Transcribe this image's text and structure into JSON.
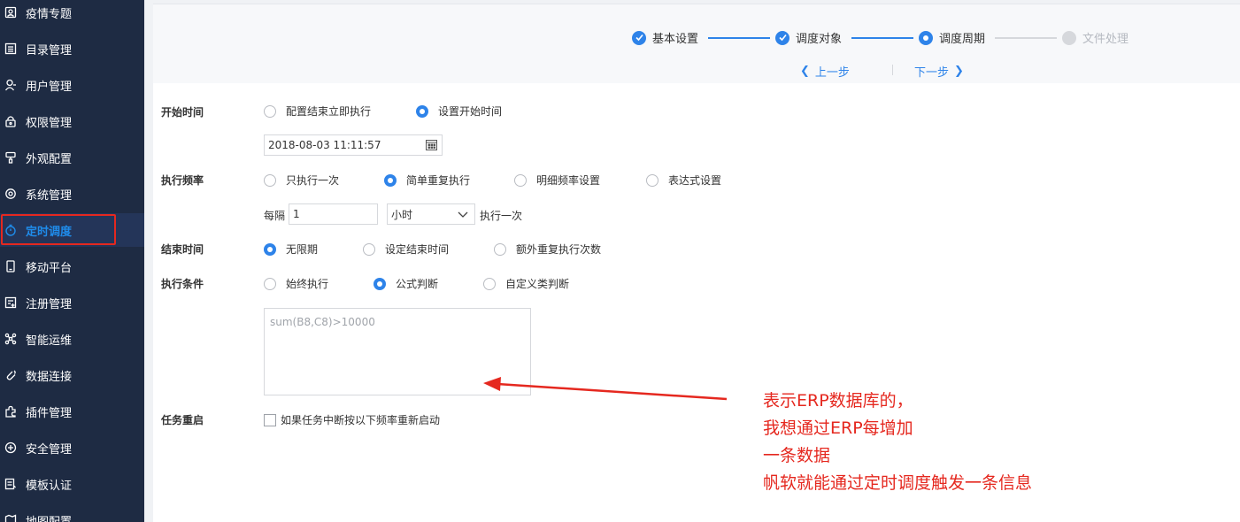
{
  "sidebar": {
    "items": [
      {
        "label": "疫情专题",
        "icon": "report-icon"
      },
      {
        "label": "目录管理",
        "icon": "list-icon"
      },
      {
        "label": "用户管理",
        "icon": "user-icon"
      },
      {
        "label": "权限管理",
        "icon": "lock-icon"
      },
      {
        "label": "外观配置",
        "icon": "brush-icon"
      },
      {
        "label": "系统管理",
        "icon": "gear-icon"
      },
      {
        "label": "定时调度",
        "icon": "timer-icon",
        "active": true
      },
      {
        "label": "移动平台",
        "icon": "mobile-icon"
      },
      {
        "label": "注册管理",
        "icon": "register-icon"
      },
      {
        "label": "智能运维",
        "icon": "network-icon"
      },
      {
        "label": "数据连接",
        "icon": "link-icon"
      },
      {
        "label": "插件管理",
        "icon": "puzzle-icon"
      },
      {
        "label": "安全管理",
        "icon": "shield-icon"
      },
      {
        "label": "模板认证",
        "icon": "template-icon"
      },
      {
        "label": "地图配置",
        "icon": "map-icon"
      }
    ],
    "active_color": "#1f8ceb"
  },
  "steps": [
    {
      "label": "基本设置",
      "status": "done"
    },
    {
      "label": "调度对象",
      "status": "done"
    },
    {
      "label": "调度周期",
      "status": "current"
    },
    {
      "label": "文件处理",
      "status": "pending"
    }
  ],
  "nav": {
    "prev": "上一步",
    "next": "下一步"
  },
  "form": {
    "start_time": {
      "label": "开始时间",
      "options": [
        "配置结束立即执行",
        "设置开始时间"
      ],
      "selected": 1,
      "datetime": "2018-08-03 11:11:57"
    },
    "frequency": {
      "label": "执行频率",
      "options": [
        "只执行一次",
        "简单重复执行",
        "明细频率设置",
        "表达式设置"
      ],
      "selected": 1,
      "every_label": "每隔",
      "every_value": "1",
      "unit": "小时",
      "suffix": "执行一次"
    },
    "end_time": {
      "label": "结束时间",
      "options": [
        "无限期",
        "设定结束时间",
        "额外重复执行次数"
      ],
      "selected": 0
    },
    "condition": {
      "label": "执行条件",
      "options": [
        "始终执行",
        "公式判断",
        "自定义类判断"
      ],
      "selected": 1,
      "formula": "sum(B8,C8)>10000"
    },
    "restart": {
      "label": "任务重启",
      "checkbox_label": "如果任务中断按以下频率重新启动",
      "checked": false
    }
  },
  "annotation": {
    "lines": [
      "表示ERP数据库的，",
      "我想通过ERP每增加",
      "一条数据",
      "帆软就能通过定时调度触发一条信息"
    ],
    "color": "#e5281f"
  },
  "accent_color": "#2e83e9"
}
